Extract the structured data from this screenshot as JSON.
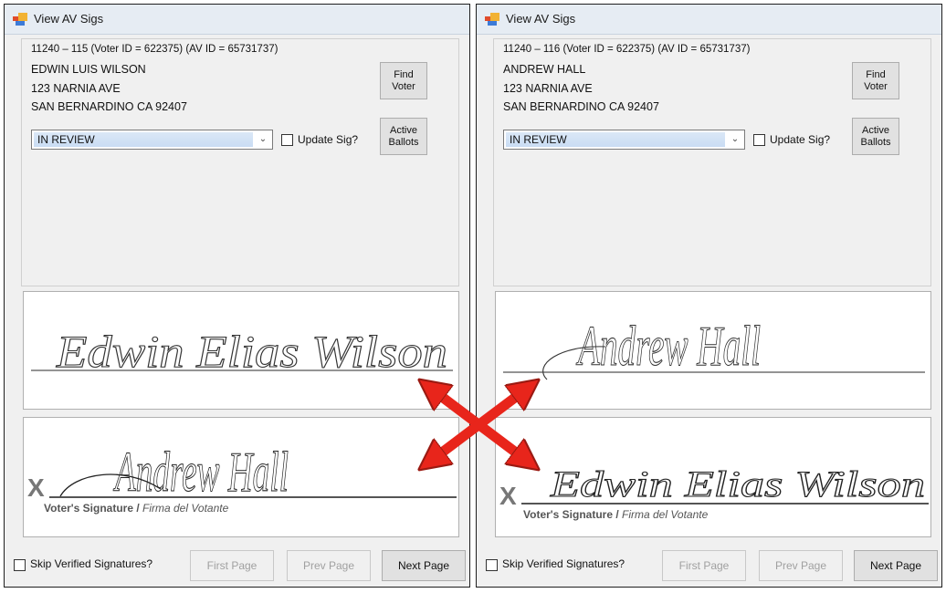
{
  "left_window": {
    "title": "View AV Sigs",
    "record_line": "11240 – 115 (Voter ID = 622375) (AV ID = 65731737)",
    "name": "EDWIN LUIS WILSON",
    "address": "123 NARNIA AVE",
    "city": "SAN BERNARDINO CA 92407",
    "find_voter_label": "Find Voter",
    "active_ballots_label": "Active Ballots",
    "status_value": "IN REVIEW",
    "update_sig_label": "Update Sig?",
    "reference_signature": "Edwin Elias Wilson",
    "ballot_signature": "Andrew Hall",
    "ballot_caption_plain": "Voter's Signature / ",
    "ballot_caption_italic": "Firma del Votante",
    "skip_label": "Skip Verified Signatures?",
    "first_page_label": "First Page",
    "prev_page_label": "Prev Page",
    "next_page_label": "Next Page",
    "x_mark": "X"
  },
  "right_window": {
    "title": "View AV Sigs",
    "record_line": "11240 – 116 (Voter ID = 622375) (AV ID = 65731737)",
    "name": "ANDREW HALL",
    "address": "123 NARNIA AVE",
    "city": "SAN BERNARDINO CA 92407",
    "find_voter_label": "Find Voter",
    "active_ballots_label": "Active Ballots",
    "status_value": "IN REVIEW",
    "update_sig_label": "Update Sig?",
    "reference_signature": "Andrew Hall",
    "ballot_signature": "Edwin Elias Wilson",
    "ballot_caption_plain": "Voter's Signature / ",
    "ballot_caption_italic": "Firma del Votante",
    "skip_label": "Skip Verified Signatures?",
    "first_page_label": "First Page",
    "prev_page_label": "Prev Page",
    "next_page_label": "Next Page",
    "x_mark": "X"
  },
  "colors": {
    "swap_arrow": "#e8251b",
    "titlebar": "#e6ecf3",
    "window_bg": "#f0f0f0"
  },
  "icons": {
    "app": "app-window-icon",
    "swap": "swap-cross-arrows-icon"
  }
}
